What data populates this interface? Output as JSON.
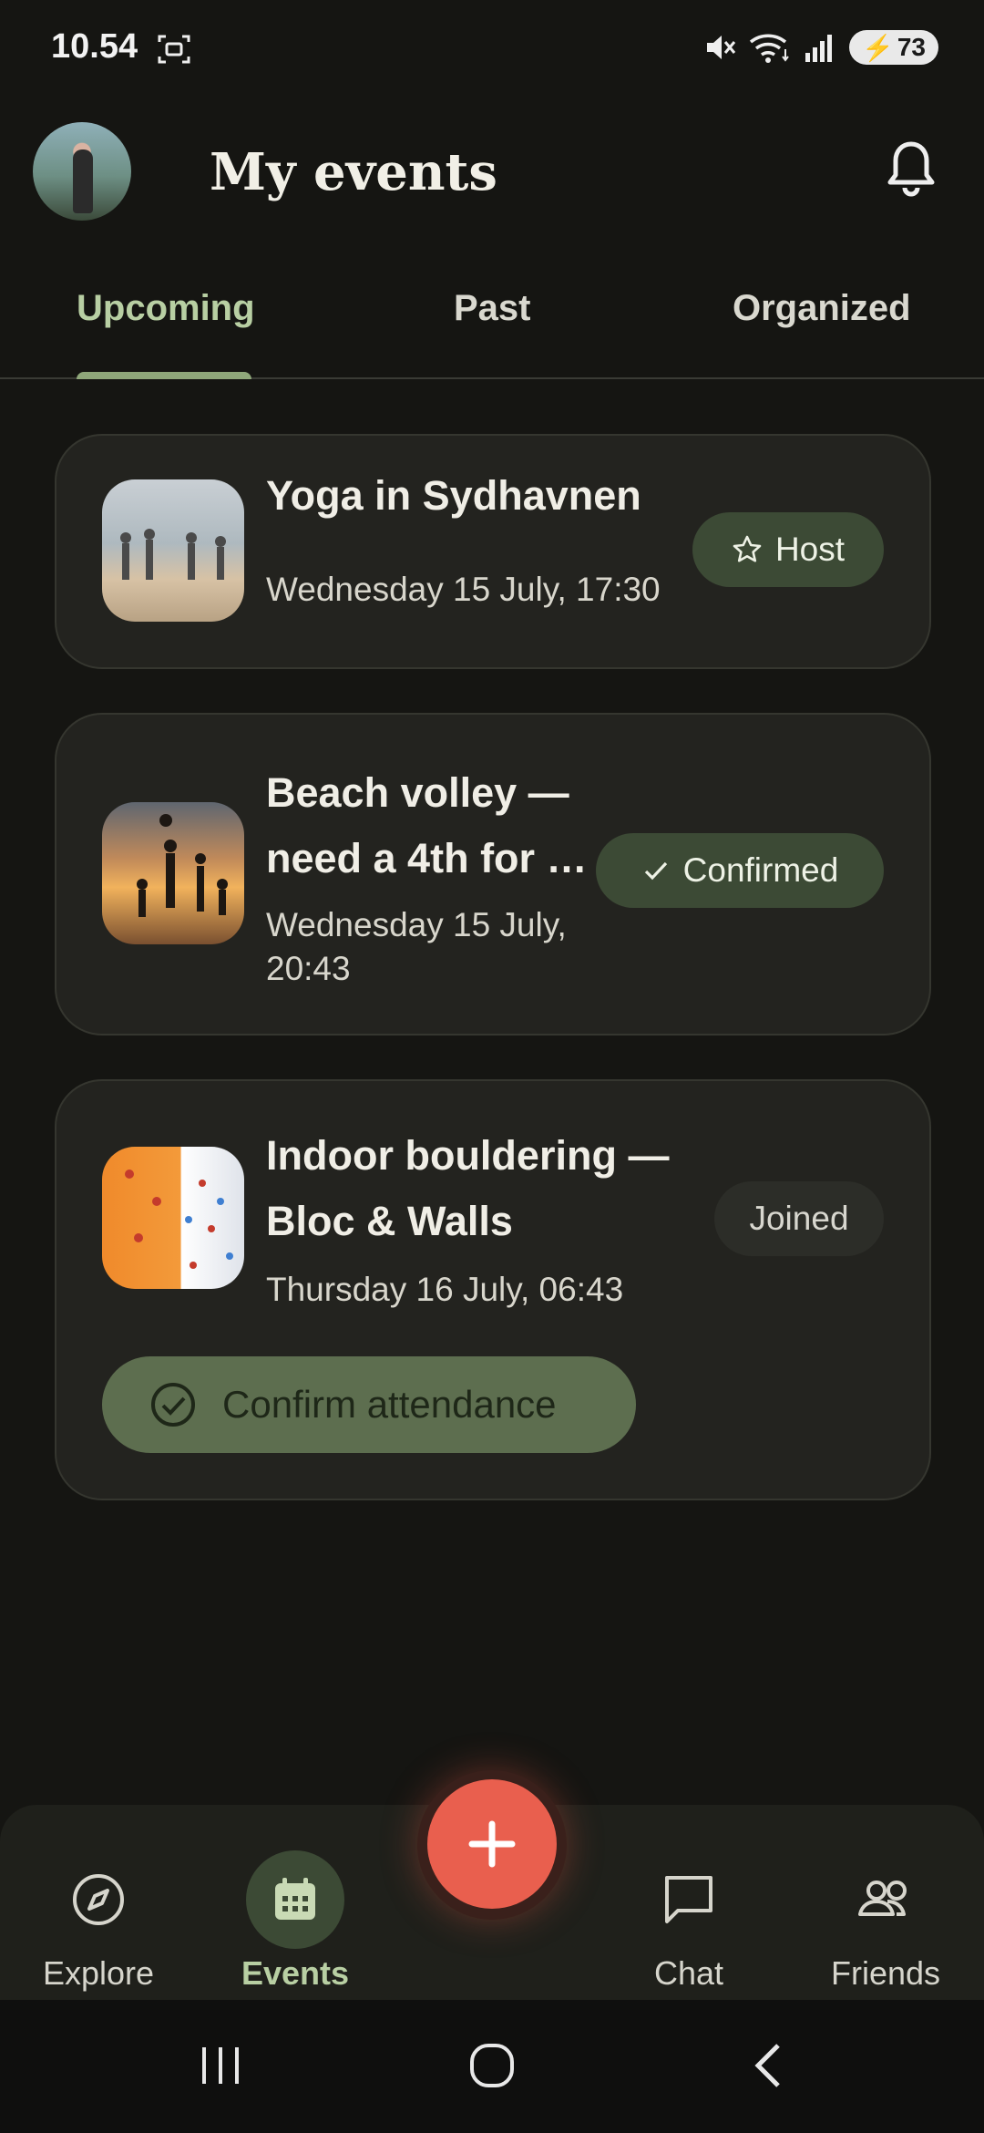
{
  "status_bar": {
    "time": "10.54",
    "battery": "73"
  },
  "header": {
    "title": "My events"
  },
  "tabs": [
    {
      "label": "Upcoming",
      "active": true
    },
    {
      "label": "Past",
      "active": false
    },
    {
      "label": "Organized",
      "active": false
    }
  ],
  "events": [
    {
      "title": "Yoga in Sydhavnen",
      "date": "Wednesday 15 July, 17:30",
      "badge": "Host"
    },
    {
      "title_line1": "Beach volley —",
      "title_line2": "need a 4th for …",
      "date_line1": "Wednesday 15 July,",
      "date_line2": "20:43",
      "badge": "Confirmed"
    },
    {
      "title_line1": "Indoor bouldering —",
      "title_line2": "Bloc & Walls",
      "date": "Thursday 16 July, 06:43",
      "badge": "Joined",
      "action": "Confirm attendance"
    }
  ],
  "bottom_nav": [
    {
      "label": "Explore",
      "icon": "compass-icon",
      "active": false
    },
    {
      "label": "Events",
      "icon": "calendar-icon",
      "active": true
    },
    {
      "label": "Chat",
      "icon": "chat-bubble-icon",
      "active": false
    },
    {
      "label": "Friends",
      "icon": "people-icon",
      "active": false
    }
  ],
  "fab": {
    "icon": "plus-icon"
  },
  "colors": {
    "accent": "#b8cfa3",
    "fab": "#e95f4e",
    "chip_bg": "#3c4a35",
    "background": "#151512"
  }
}
